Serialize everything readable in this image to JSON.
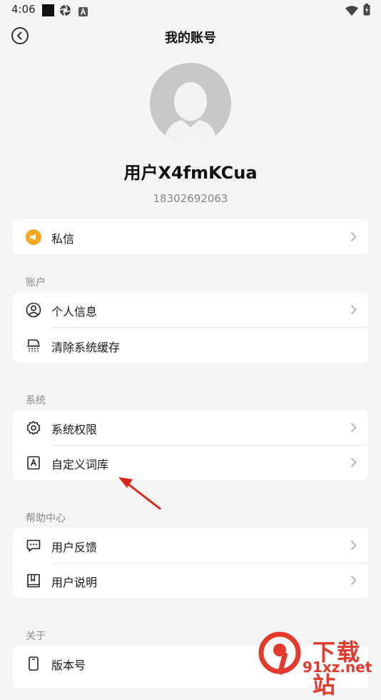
{
  "status": {
    "time": "4:06"
  },
  "header": {
    "title": "我的账号"
  },
  "profile": {
    "name": "用户X4fmKCua",
    "phone": "18302692063"
  },
  "message_row": {
    "label": "私信"
  },
  "sections": {
    "account": {
      "title": "账户",
      "items": [
        {
          "label": "个人信息"
        },
        {
          "label": "清除系统缓存"
        }
      ]
    },
    "system": {
      "title": "系统",
      "items": [
        {
          "label": "系统权限"
        },
        {
          "label": "自定义词库"
        }
      ]
    },
    "help": {
      "title": "帮助中心",
      "items": [
        {
          "label": "用户反馈"
        },
        {
          "label": "用户说明"
        }
      ]
    },
    "about": {
      "title": "关于",
      "items": [
        {
          "label": "版本号"
        }
      ]
    }
  },
  "watermark": {
    "line1": "下载站",
    "line2": "91xz.net"
  },
  "colors": {
    "message_icon": "#f5a623",
    "annotation_arrow": "#d9261c",
    "watermark": "#e23a2c"
  }
}
